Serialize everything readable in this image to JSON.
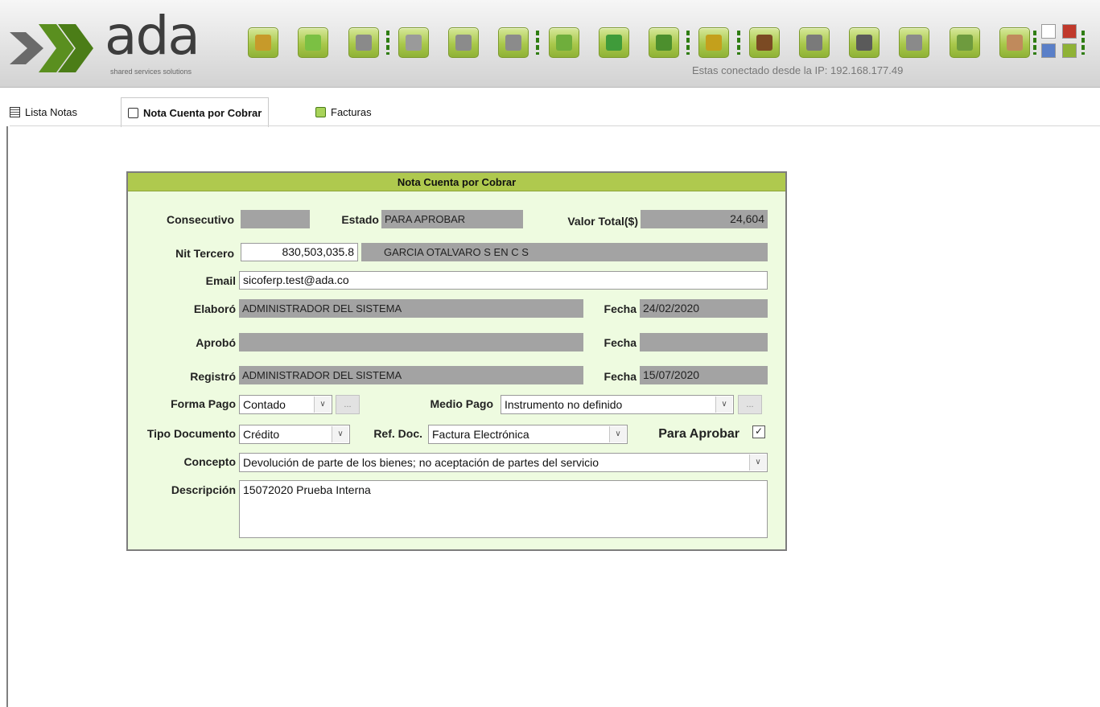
{
  "header": {
    "logo_text": "ada",
    "logo_tagline": "shared services solutions",
    "ip_status": "Estas conectado desde la IP: 192.168.177.49"
  },
  "toolbar": {
    "buttons": [
      {
        "name": "open-folder-icon",
        "color": "#c79a2a"
      },
      {
        "name": "new-document-icon",
        "color": "#7bc043"
      },
      {
        "name": "save-icon",
        "color": "#8a8a8a"
      },
      {
        "name": "cancel-document-icon",
        "color": "#9a9a9a"
      },
      {
        "name": "undo-icon",
        "color": "#8b8b8b"
      },
      {
        "name": "print-icon",
        "color": "#8b8b8b"
      },
      {
        "name": "search-icon",
        "color": "#6fae3c"
      },
      {
        "name": "export-excel-icon",
        "color": "#3f9b3a"
      },
      {
        "name": "open-box-icon",
        "color": "#4c8f2d"
      },
      {
        "name": "approve-lock-icon",
        "color": "#c4a01c"
      },
      {
        "name": "money-bag-icon",
        "color": "#7b4a23"
      },
      {
        "name": "camera-icon",
        "color": "#7a7a7a"
      },
      {
        "name": "grid-icon",
        "color": "#5a5a5a"
      },
      {
        "name": "cart-icon",
        "color": "#8a8a8a"
      },
      {
        "name": "edit-note-icon",
        "color": "#6e9b3e"
      },
      {
        "name": "users-icon",
        "color": "#c08a5c"
      }
    ]
  },
  "tabs": [
    {
      "label": "Lista Notas",
      "icon": "list-icon"
    },
    {
      "label": "Nota Cuenta por Cobrar",
      "icon": "note-icon",
      "active": true
    },
    {
      "label": "Facturas",
      "icon": "invoices-icon"
    }
  ],
  "form": {
    "title": "Nota Cuenta por Cobrar",
    "consecutivo_label": "Consecutivo",
    "consecutivo_value": "",
    "estado_label": "Estado",
    "estado_value": "PARA APROBAR",
    "valor_total_label": "Valor Total($)",
    "valor_total_value": "24,604",
    "nit_label": "Nit Tercero",
    "nit_value": "830,503,035.8",
    "tercero_nombre": "GARCIA OTALVARO S EN C S",
    "email_label": "Email",
    "email_value": "sicoferp.test@ada.co",
    "elaboro_label": "Elaboró",
    "elaboro_value": "ADMINISTRADOR DEL SISTEMA",
    "fecha_label": "Fecha",
    "elaboro_fecha": "24/02/2020",
    "aprobo_label": "Aprobó",
    "aprobo_value": "",
    "aprobo_fecha": "",
    "registro_label": "Registró",
    "registro_value": "ADMINISTRADOR DEL SISTEMA",
    "registro_fecha": "15/07/2020",
    "forma_pago_label": "Forma Pago",
    "forma_pago_value": "Contado",
    "medio_pago_label": "Medio Pago",
    "medio_pago_value": "Instrumento no definido",
    "tipo_documento_label": "Tipo Documento",
    "tipo_documento_value": "Crédito",
    "ref_doc_label": "Ref. Doc.",
    "ref_doc_value": "Factura Electrónica",
    "para_aprobar_label": "Para Aprobar",
    "para_aprobar_checked": true,
    "concepto_label": "Concepto",
    "concepto_value": "Devolución de parte de los bienes; no aceptación de partes del servicio",
    "descripcion_label": "Descripción",
    "descripcion_value": "15072020 Prueba Interna",
    "ellipsis": "..."
  }
}
